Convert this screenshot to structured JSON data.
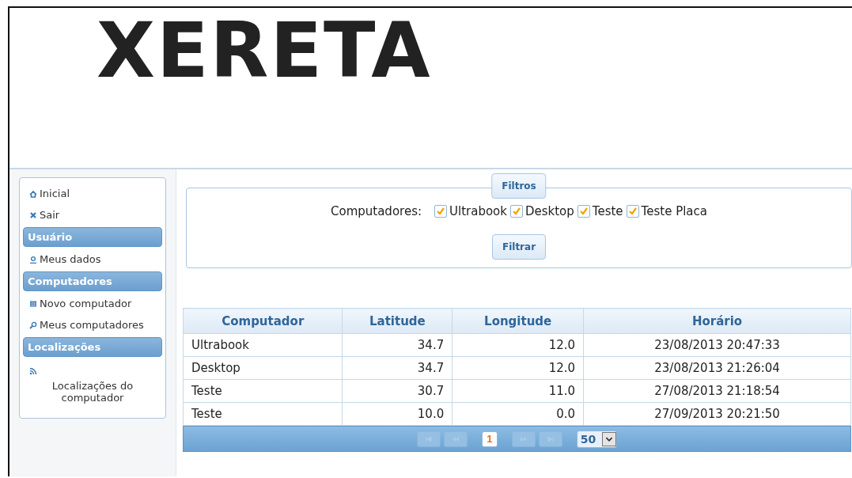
{
  "logo": "XERETA",
  "sidebar": {
    "items": [
      {
        "kind": "link",
        "label": "Inicial"
      },
      {
        "kind": "link",
        "label": "Sair"
      },
      {
        "kind": "header",
        "label": "Usuário"
      },
      {
        "kind": "link",
        "label": "Meus dados"
      },
      {
        "kind": "header",
        "label": "Computadores"
      },
      {
        "kind": "link",
        "label": "Novo computador"
      },
      {
        "kind": "link",
        "label": "Meus computadores"
      },
      {
        "kind": "header",
        "label": "Localizações"
      },
      {
        "kind": "block",
        "label": "Localizações do computador"
      }
    ]
  },
  "filters": {
    "legend": "Filtros",
    "label": "Computadores:",
    "options": [
      {
        "label": "Ultrabook",
        "checked": true
      },
      {
        "label": "Desktop",
        "checked": true
      },
      {
        "label": "Teste",
        "checked": true
      },
      {
        "label": "Teste Placa",
        "checked": true
      }
    ],
    "button": "Filtrar"
  },
  "table": {
    "columns": [
      "Computador",
      "Latitude",
      "Longitude",
      "Horário"
    ],
    "rows": [
      [
        "Ultrabook",
        "34.7",
        "12.0",
        "23/08/2013 20:47:33"
      ],
      [
        "Desktop",
        "34.7",
        "12.0",
        "23/08/2013 21:26:04"
      ],
      [
        "Teste",
        "30.7",
        "11.0",
        "27/08/2013 21:18:54"
      ],
      [
        "Teste",
        "10.0",
        "0.0",
        "27/09/2013 20:21:50"
      ]
    ]
  },
  "pager": {
    "buttons": [
      {
        "kind": "first",
        "disabled": true
      },
      {
        "kind": "prev",
        "disabled": true
      },
      {
        "kind": "page",
        "label": "1",
        "selected": true
      },
      {
        "kind": "next",
        "disabled": true
      },
      {
        "kind": "last",
        "disabled": true
      }
    ],
    "page_size": "50"
  }
}
